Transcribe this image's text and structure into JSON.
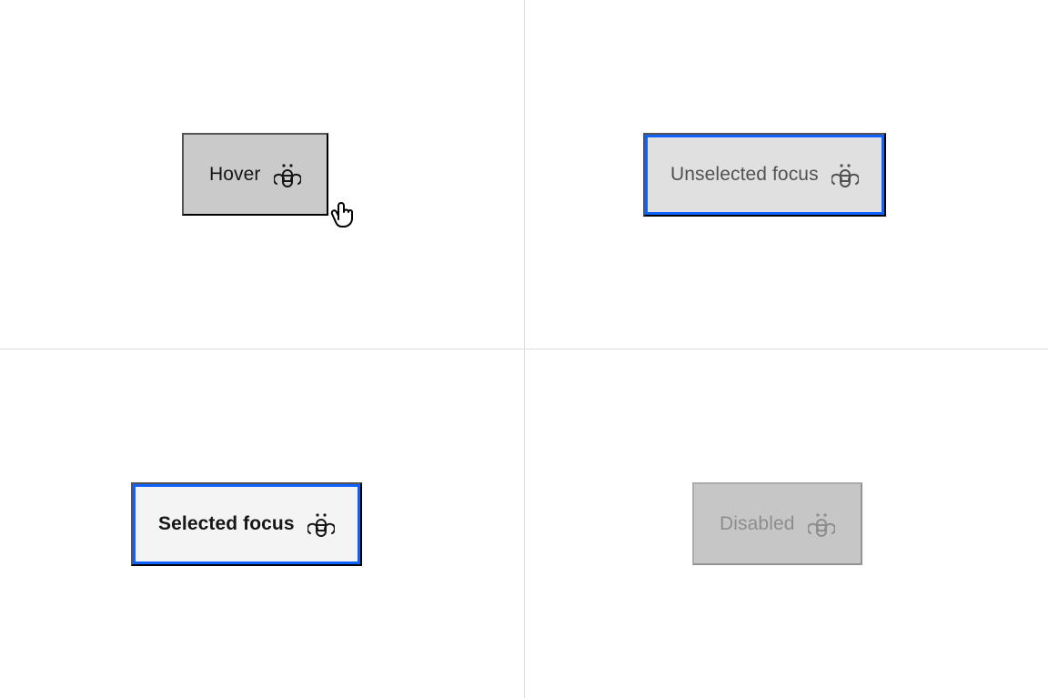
{
  "states": {
    "hover": {
      "label": "Hover",
      "icon": "bee-icon"
    },
    "unselected_focus": {
      "label": "Unselected focus",
      "icon": "bee-icon"
    },
    "selected_focus": {
      "label": "Selected focus",
      "icon": "bee-icon"
    },
    "disabled": {
      "label": "Disabled",
      "icon": "bee-icon"
    }
  },
  "colors": {
    "focus_ring": "#0f62fe",
    "hover_bg": "#cacaca",
    "unselected_bg": "#e0e0e0",
    "selected_bg": "#f4f4f4",
    "disabled_bg": "#c6c6c6",
    "text_primary": "#161616",
    "text_secondary": "#525252",
    "text_disabled": "#8d8d8d",
    "divider": "#dcdcdc"
  }
}
